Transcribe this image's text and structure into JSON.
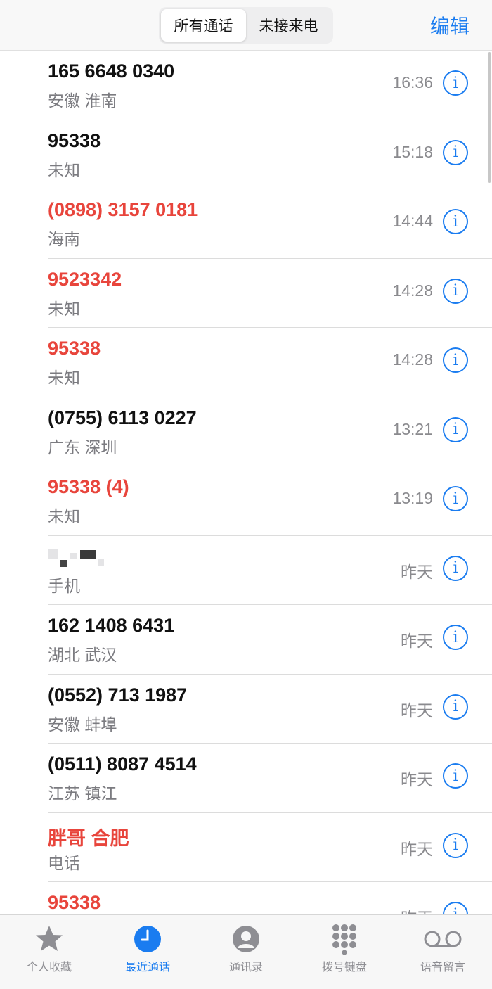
{
  "header": {
    "segments": [
      "所有通话",
      "未接来电"
    ],
    "selected_segment": "所有通话",
    "edit_label": "编辑"
  },
  "calls": [
    {
      "name": "165 6648 0340",
      "sub": "安徽 淮南",
      "time": "16:36",
      "missed": false
    },
    {
      "name": "95338",
      "sub": "未知",
      "time": "15:18",
      "missed": false
    },
    {
      "name": "(0898) 3157 0181",
      "sub": "海南",
      "time": "14:44",
      "missed": true
    },
    {
      "name": "9523342",
      "sub": "未知",
      "time": "14:28",
      "missed": true
    },
    {
      "name": "95338",
      "sub": "未知",
      "time": "14:28",
      "missed": true
    },
    {
      "name": "(0755) 6113 0227",
      "sub": "广东 深圳",
      "time": "13:21",
      "missed": false
    },
    {
      "name": "95338 (4)",
      "sub": "未知",
      "time": "13:19",
      "missed": true
    },
    {
      "name": "",
      "sub": "手机",
      "time": "昨天",
      "missed": false,
      "redacted": true
    },
    {
      "name": "162 1408 6431",
      "sub": "湖北 武汉",
      "time": "昨天",
      "missed": false
    },
    {
      "name": "(0552) 713 1987",
      "sub": "安徽 蚌埠",
      "time": "昨天",
      "missed": false
    },
    {
      "name": "(0511) 8087 4514",
      "sub": "江苏 镇江",
      "time": "昨天",
      "missed": false
    },
    {
      "name": "胖哥 合肥",
      "sub": "电话",
      "time": "昨天",
      "missed": true
    },
    {
      "name": "95338",
      "sub": "",
      "time": "昨天",
      "missed": true
    }
  ],
  "info_glyph": "i",
  "tabbar": [
    {
      "label": "个人收藏",
      "icon": "star-icon",
      "active": false
    },
    {
      "label": "最近通话",
      "icon": "clock-icon",
      "active": true
    },
    {
      "label": "通讯录",
      "icon": "person-circle-icon",
      "active": false
    },
    {
      "label": "拨号键盘",
      "icon": "keypad-icon",
      "active": false
    },
    {
      "label": "语音留言",
      "icon": "voicemail-icon",
      "active": false
    }
  ],
  "colors": {
    "accent": "#1a7cf0",
    "missed": "#e8453c",
    "secondary": "#8a8a8e"
  }
}
